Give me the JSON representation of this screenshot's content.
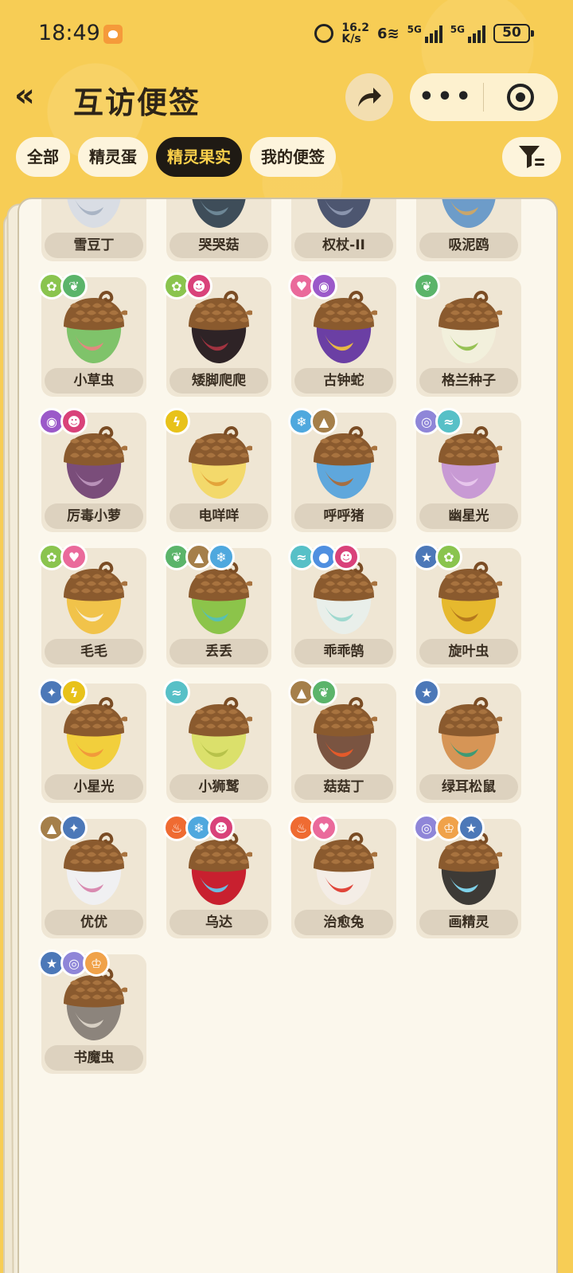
{
  "status_bar": {
    "time": "18:49",
    "net_speed_value": "16.2",
    "net_speed_unit": "K/s",
    "wifi_label": "6",
    "sim1_label": "5G",
    "sim2_label": "5G",
    "battery": "50"
  },
  "header": {
    "back_label": "«",
    "title": "互访便签",
    "more_label": "•••"
  },
  "tabs": [
    {
      "label": "全部",
      "active": false
    },
    {
      "label": "精灵蛋",
      "active": false
    },
    {
      "label": "精灵果实",
      "active": true
    },
    {
      "label": "我的便签",
      "active": false
    }
  ],
  "colors": {
    "background": "#f7cd55",
    "tab_active_bg": "#1f1a14",
    "tab_active_text": "#fbd04b",
    "panel": "#fbf7ec",
    "card": "#efe6d4",
    "grass": "#5bb46a",
    "bug": "#8ac44e",
    "demon": "#d9427a",
    "cute": "#ea6a9b",
    "poison": "#9b59c9",
    "electric": "#e8c21a",
    "ice": "#4fa8de",
    "earth": "#a57f4a",
    "phantom": "#8f86d8",
    "wing": "#57c0c7",
    "water": "#4f8fe0",
    "normal": "#4c78b8",
    "fire": "#ef6b32",
    "mech": "#f0a24a"
  },
  "fruits": [
    {
      "name": "雪豆丁",
      "badges": [],
      "shell": "#d9dde4",
      "accent": "#a9b4c4"
    },
    {
      "name": "哭哭菇",
      "badges": [],
      "shell": "#3e4d59",
      "accent": "#6d8796"
    },
    {
      "name": "权杖-II",
      "badges": [],
      "shell": "#4d5670",
      "accent": "#8a94ad"
    },
    {
      "name": "吸泥鸥",
      "badges": [],
      "shell": "#6d9cc9",
      "accent": "#c9a66b"
    },
    {
      "name": "小草虫",
      "badges": [
        {
          "type": "bug",
          "icon": "bug-icon",
          "glyph": "✿"
        },
        {
          "type": "grass",
          "icon": "leaf-icon",
          "glyph": "❦"
        }
      ],
      "shell": "#7fc36a",
      "accent": "#e2897f"
    },
    {
      "name": "矮脚爬爬",
      "badges": [
        {
          "type": "bug",
          "icon": "bug-icon",
          "glyph": "✿"
        },
        {
          "type": "demon",
          "icon": "demon-icon",
          "glyph": "☻"
        }
      ],
      "shell": "#2e2326",
      "accent": "#a23340"
    },
    {
      "name": "古钟蛇",
      "badges": [
        {
          "type": "cute",
          "icon": "heart-icon",
          "glyph": "♥"
        },
        {
          "type": "poison",
          "icon": "poison-icon",
          "glyph": "◉"
        }
      ],
      "shell": "#6b3fa4",
      "accent": "#e8b844"
    },
    {
      "name": "格兰种子",
      "badges": [
        {
          "type": "grass",
          "icon": "leaf-icon",
          "glyph": "❦"
        }
      ],
      "shell": "#f2f0dc",
      "accent": "#97c255"
    },
    {
      "name": "厉毒小萝",
      "badges": [
        {
          "type": "poison",
          "icon": "poison-icon",
          "glyph": "◉"
        },
        {
          "type": "demon",
          "icon": "demon-icon",
          "glyph": "☻"
        }
      ],
      "shell": "#7a4d7a",
      "accent": "#b991b9"
    },
    {
      "name": "电咩咩",
      "badges": [
        {
          "type": "electric",
          "icon": "lightning-icon",
          "glyph": "ϟ"
        }
      ],
      "shell": "#f3d96b",
      "accent": "#e3a43a"
    },
    {
      "name": "呼呼猪",
      "badges": [
        {
          "type": "ice",
          "icon": "snowflake-icon",
          "glyph": "❄"
        },
        {
          "type": "earth",
          "icon": "mountain-icon",
          "glyph": "▲"
        }
      ],
      "shell": "#5fa7dc",
      "accent": "#a56f43"
    },
    {
      "name": "幽星光",
      "badges": [
        {
          "type": "phantom",
          "icon": "spiral-icon",
          "glyph": "◎"
        },
        {
          "type": "wing",
          "icon": "wing-icon",
          "glyph": "≈"
        }
      ],
      "shell": "#c89ad4",
      "accent": "#e7c6ec"
    },
    {
      "name": "毛毛",
      "badges": [
        {
          "type": "bug",
          "icon": "bug-icon",
          "glyph": "✿"
        },
        {
          "type": "cute",
          "icon": "heart-icon",
          "glyph": "♥"
        }
      ],
      "shell": "#f1c34a",
      "accent": "#f7f0dc"
    },
    {
      "name": "丢丢",
      "badges": [
        {
          "type": "grass",
          "icon": "leaf-icon",
          "glyph": "❦"
        },
        {
          "type": "earth",
          "icon": "mountain-icon",
          "glyph": "▲"
        },
        {
          "type": "ice",
          "icon": "snowflake-icon",
          "glyph": "❄"
        }
      ],
      "shell": "#8cc44a",
      "accent": "#57c0b2"
    },
    {
      "name": "乖乖鹄",
      "badges": [
        {
          "type": "wing",
          "icon": "wing-icon",
          "glyph": "≈"
        },
        {
          "type": "water",
          "icon": "drop-icon",
          "glyph": "●"
        },
        {
          "type": "demon",
          "icon": "demon-icon",
          "glyph": "☻"
        }
      ],
      "shell": "#e9efea",
      "accent": "#9fd9cf"
    },
    {
      "name": "旋叶虫",
      "badges": [
        {
          "type": "normal",
          "icon": "star-icon",
          "glyph": "★"
        },
        {
          "type": "bug",
          "icon": "bug-icon",
          "glyph": "✿"
        }
      ],
      "shell": "#e6b92e",
      "accent": "#b5791d"
    },
    {
      "name": "小星光",
      "badges": [
        {
          "type": "normal",
          "icon": "star-icon",
          "glyph": "✦"
        },
        {
          "type": "electric",
          "icon": "lightning-icon",
          "glyph": "ϟ"
        }
      ],
      "shell": "#f2cf3c",
      "accent": "#f29a3a"
    },
    {
      "name": "小狮鹫",
      "badges": [
        {
          "type": "wing",
          "icon": "wing-icon",
          "glyph": "≈"
        }
      ],
      "shell": "#dbe06b",
      "accent": "#b7c24a"
    },
    {
      "name": "菇菇丁",
      "badges": [
        {
          "type": "earth",
          "icon": "mountain-icon",
          "glyph": "▲"
        },
        {
          "type": "grass",
          "icon": "leaf-icon",
          "glyph": "❦"
        }
      ],
      "shell": "#7a5441",
      "accent": "#e45a2a"
    },
    {
      "name": "绿耳松鼠",
      "badges": [
        {
          "type": "normal",
          "icon": "star-icon",
          "glyph": "★"
        }
      ],
      "shell": "#d69556",
      "accent": "#3e9a74"
    },
    {
      "name": "优优",
      "badges": [
        {
          "type": "earth",
          "icon": "mountain-icon",
          "glyph": "▲"
        },
        {
          "type": "normal",
          "icon": "star-icon",
          "glyph": "✦"
        }
      ],
      "shell": "#f0f0f2",
      "accent": "#d98ab0"
    },
    {
      "name": "乌达",
      "badges": [
        {
          "type": "fire",
          "icon": "flame-icon",
          "glyph": "♨"
        },
        {
          "type": "ice",
          "icon": "snowflake-icon",
          "glyph": "❄"
        },
        {
          "type": "demon",
          "icon": "demon-icon",
          "glyph": "☻"
        }
      ],
      "shell": "#c8202f",
      "accent": "#6dbbe0"
    },
    {
      "name": "治愈兔",
      "badges": [
        {
          "type": "fire",
          "icon": "flame-icon",
          "glyph": "♨"
        },
        {
          "type": "cute",
          "icon": "heart-icon",
          "glyph": "♥"
        }
      ],
      "shell": "#f4ede6",
      "accent": "#e0453a"
    },
    {
      "name": "画精灵",
      "badges": [
        {
          "type": "phantom",
          "icon": "spiral-icon",
          "glyph": "◎"
        },
        {
          "type": "mech",
          "icon": "crown-icon",
          "glyph": "♔"
        },
        {
          "type": "normal",
          "icon": "star-icon",
          "glyph": "★"
        }
      ],
      "shell": "#3d3a36",
      "accent": "#7fd2ea"
    },
    {
      "name": "书魔虫",
      "badges": [
        {
          "type": "normal",
          "icon": "star-icon",
          "glyph": "★"
        },
        {
          "type": "phantom",
          "icon": "spiral-icon",
          "glyph": "◎"
        },
        {
          "type": "mech",
          "icon": "crown-icon",
          "glyph": "♔"
        }
      ],
      "shell": "#8c847c",
      "accent": "#d8d0c4"
    }
  ]
}
